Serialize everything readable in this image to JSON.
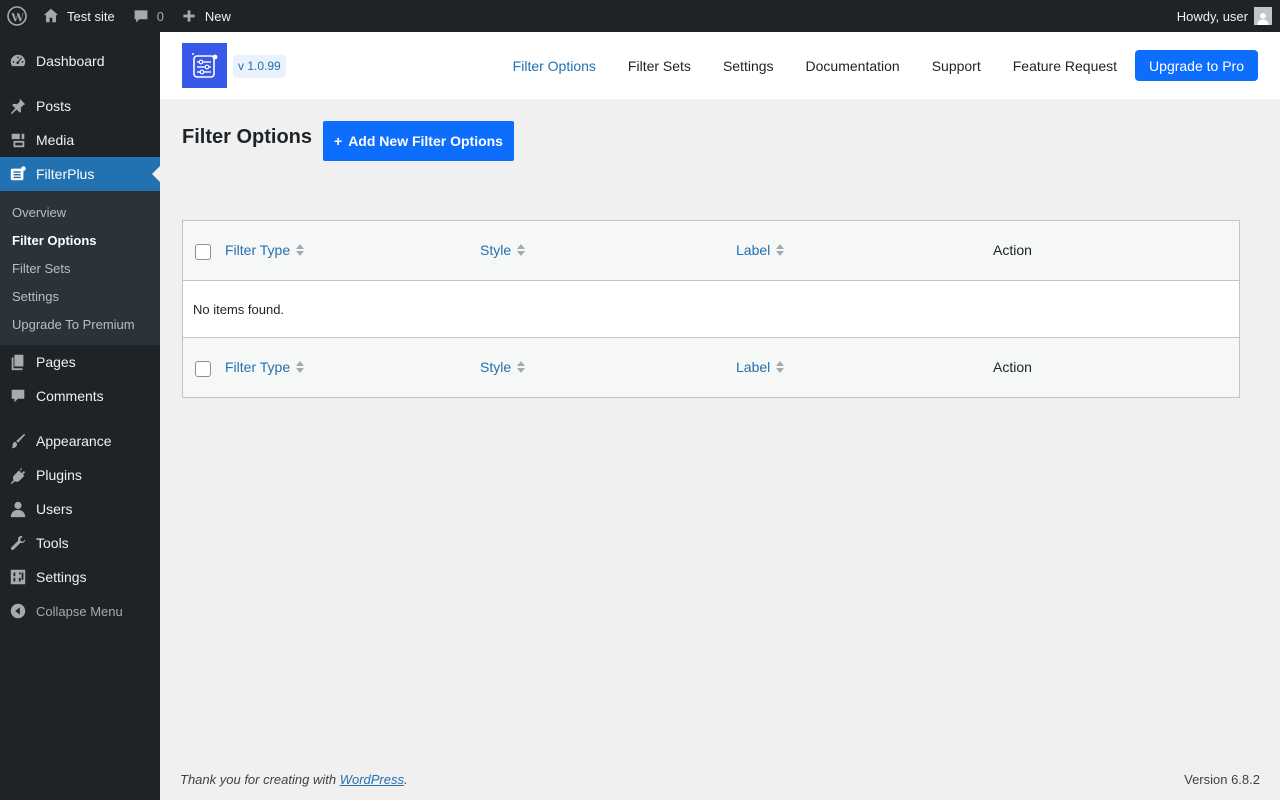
{
  "adminbar": {
    "site_name": "Test site",
    "comments_count": "0",
    "new_label": "New",
    "howdy": "Howdy, user"
  },
  "sidebar": {
    "items": [
      {
        "label": "Dashboard",
        "icon": "dashboard-icon"
      },
      {
        "label": "Posts",
        "icon": "pin-icon"
      },
      {
        "label": "Media",
        "icon": "media-icon"
      },
      {
        "label": "FilterPlus",
        "icon": "filterplus-icon"
      },
      {
        "label": "Pages",
        "icon": "pages-icon"
      },
      {
        "label": "Comments",
        "icon": "comment-icon"
      },
      {
        "label": "Appearance",
        "icon": "paintbrush-icon"
      },
      {
        "label": "Plugins",
        "icon": "plug-icon"
      },
      {
        "label": "Users",
        "icon": "user-icon"
      },
      {
        "label": "Tools",
        "icon": "wrench-icon"
      },
      {
        "label": "Settings",
        "icon": "settings-icon"
      }
    ],
    "submenu": [
      {
        "label": "Overview"
      },
      {
        "label": "Filter Options"
      },
      {
        "label": "Filter Sets"
      },
      {
        "label": "Settings"
      },
      {
        "label": "Upgrade To Premium"
      }
    ],
    "collapse_label": "Collapse Menu"
  },
  "plugin_header": {
    "version": "v 1.0.99",
    "nav": [
      {
        "label": "Filter Options"
      },
      {
        "label": "Filter Sets"
      },
      {
        "label": "Settings"
      },
      {
        "label": "Documentation"
      },
      {
        "label": "Support"
      },
      {
        "label": "Feature Request"
      }
    ],
    "upgrade_label": "Upgrade to Pro",
    "accent_color": "#0d6efd"
  },
  "main": {
    "title": "Filter Options",
    "add_button_label": "Add New Filter Options",
    "table": {
      "columns": [
        {
          "label": "Filter Type"
        },
        {
          "label": "Style"
        },
        {
          "label": "Label"
        },
        {
          "label": "Action"
        }
      ],
      "empty_text": "No items found."
    }
  },
  "footer": {
    "thanks_text": "Thank you for creating with ",
    "wp_link": "WordPress",
    "thanks_end": ".",
    "version": "Version 6.8.2"
  }
}
